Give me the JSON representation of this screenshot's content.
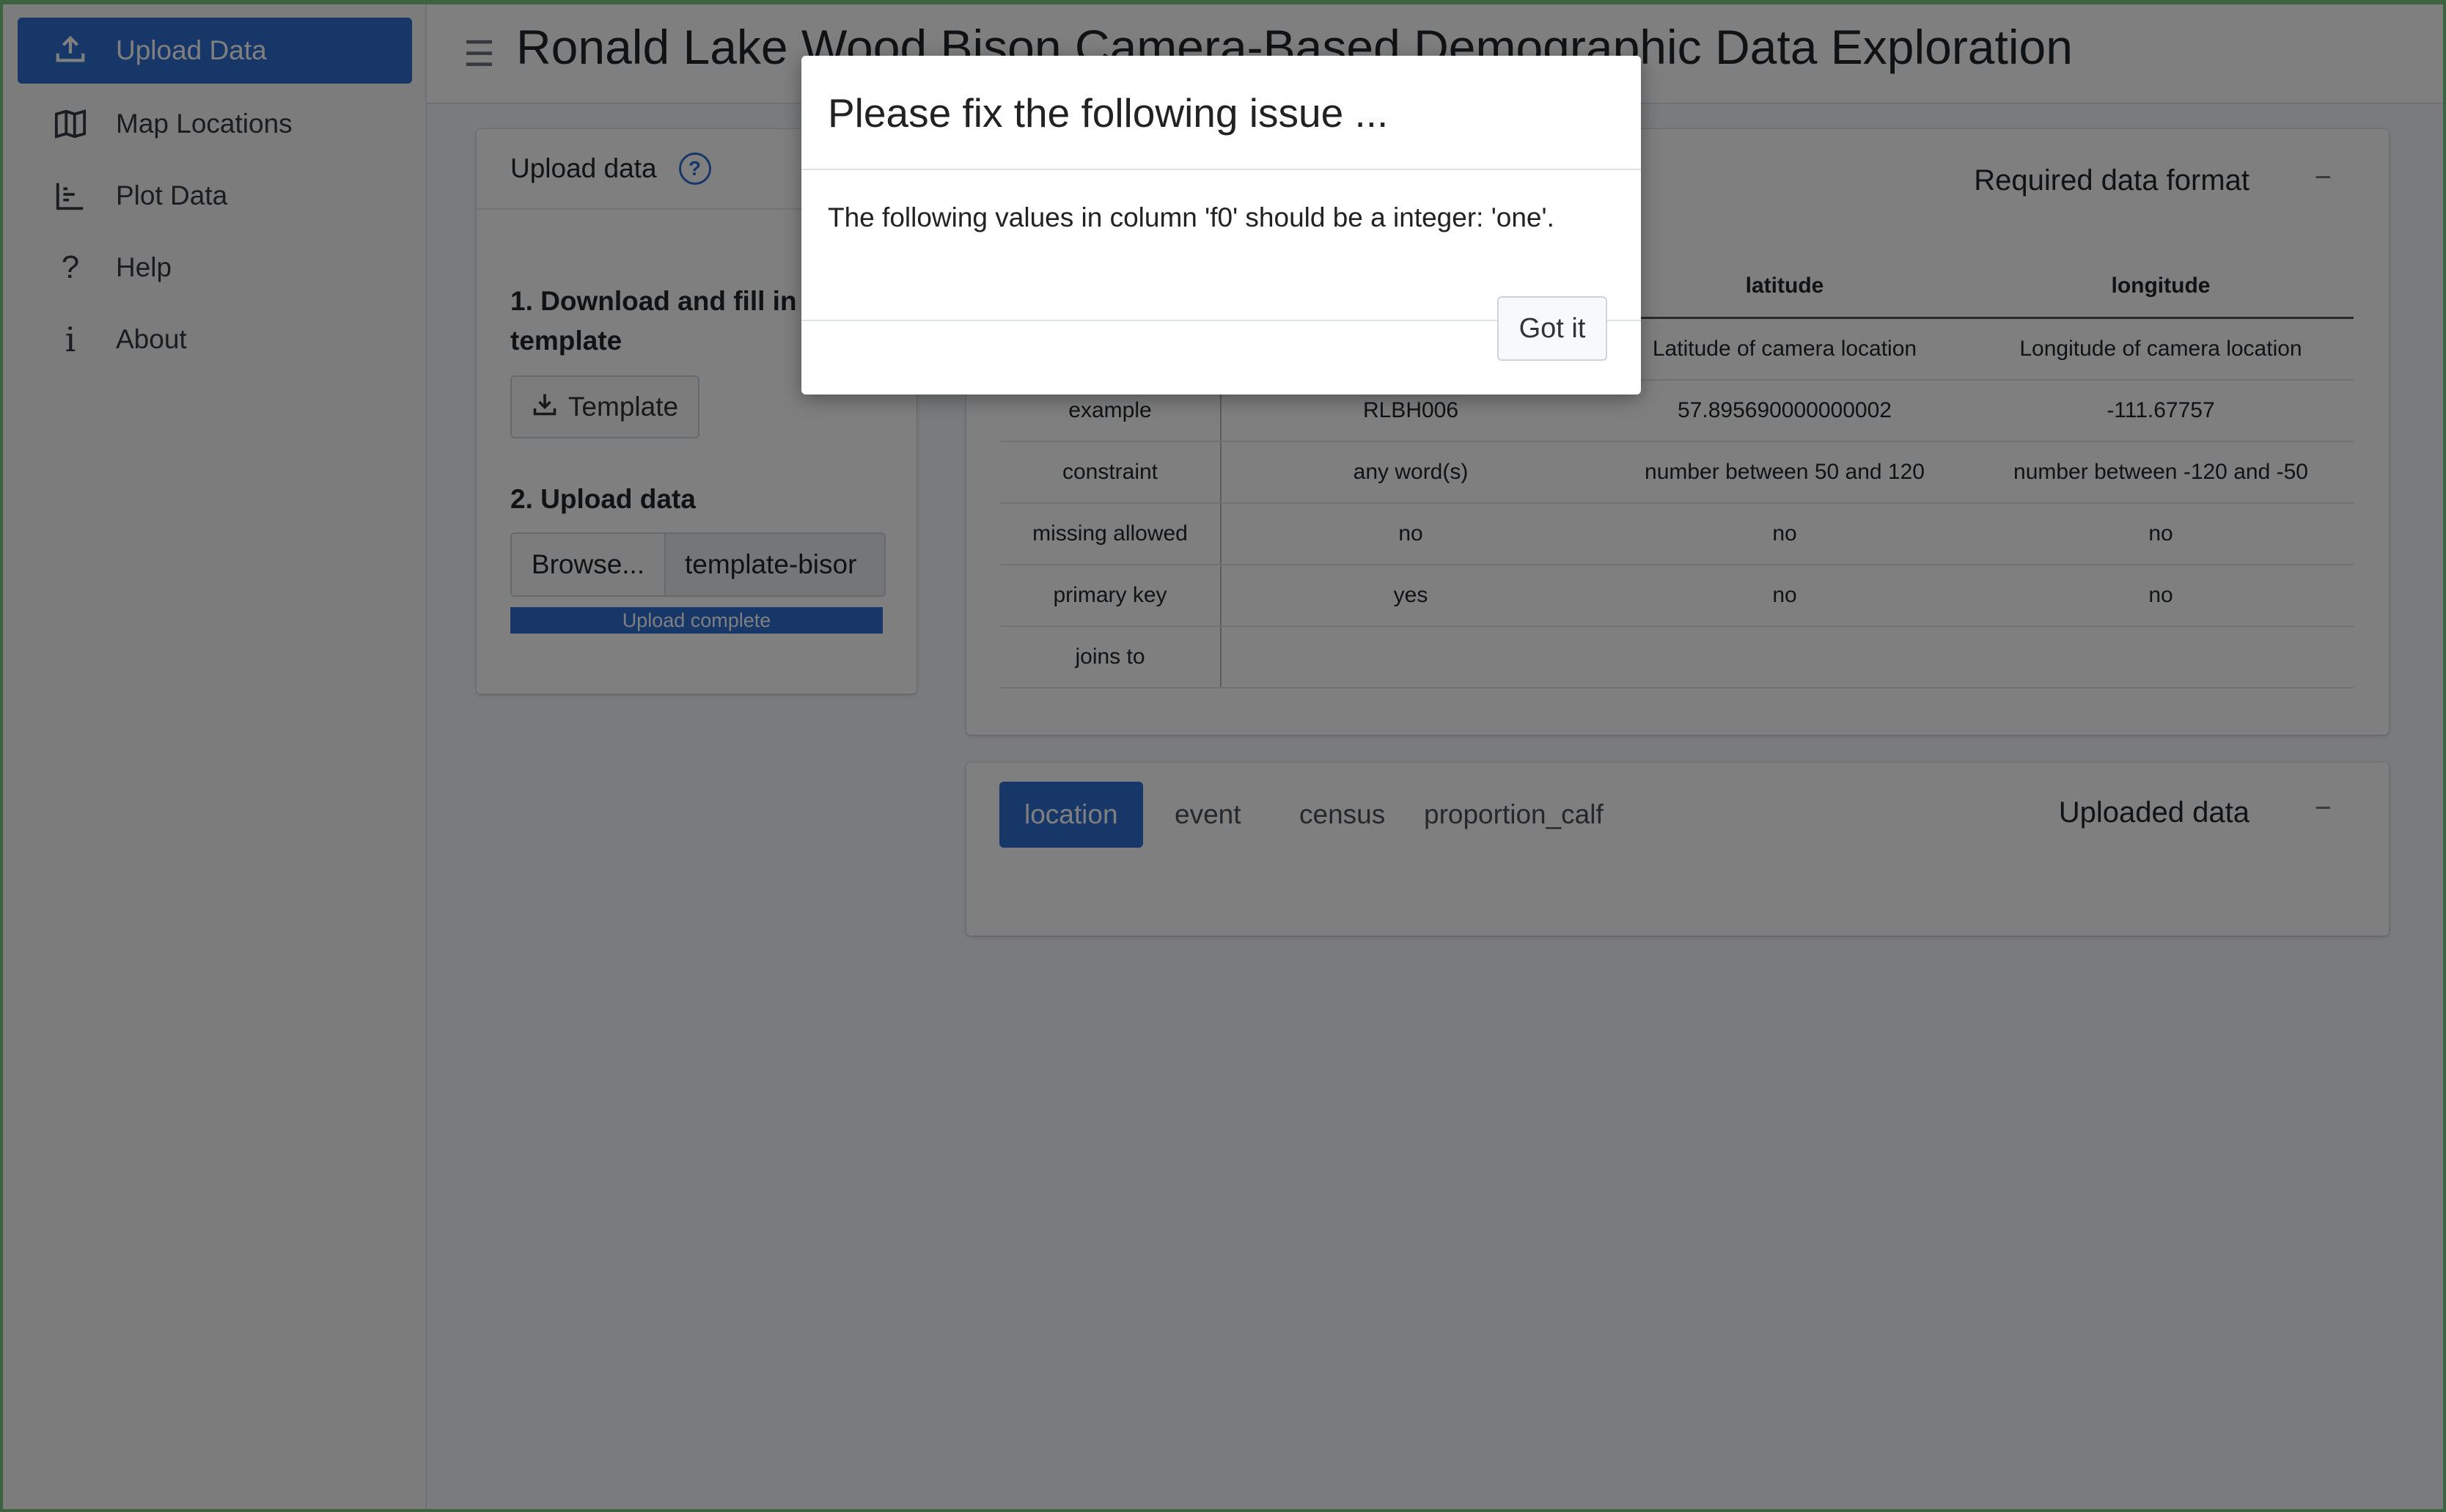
{
  "app": {
    "title": "Ronald Lake Wood Bison Camera-Based Demographic Data Exploration"
  },
  "sidebar": {
    "items": [
      {
        "label": "Upload Data",
        "icon": "upload-icon",
        "active": true
      },
      {
        "label": "Map Locations",
        "icon": "map-icon",
        "active": false
      },
      {
        "label": "Plot Data",
        "icon": "chart-icon",
        "active": false
      },
      {
        "label": "Help",
        "icon": "question-icon",
        "active": false
      },
      {
        "label": "About",
        "icon": "info-icon",
        "active": false
      }
    ]
  },
  "upload_card": {
    "title": "Upload data",
    "help_icon": "question-circle-icon",
    "step1": "1. Download and fill in template",
    "template_button": "Template",
    "step2": "2. Upload data",
    "browse_button": "Browse...",
    "file_name": "template-bisor",
    "progress_label": "Upload complete",
    "progress_value": 1.0
  },
  "format_card": {
    "title": "Required data format",
    "collapse_symbol": "−",
    "columns": [
      "",
      "",
      "latitude",
      "longitude"
    ],
    "rows": [
      [
        "",
        "",
        "Latitude of camera location",
        "Longitude of camera location"
      ],
      [
        "example",
        "RLBH006",
        "57.895690000000002",
        "-111.67757"
      ],
      [
        "constraint",
        "any word(s)",
        "number between 50 and 120",
        "number between -120 and -50"
      ],
      [
        "missing allowed",
        "no",
        "no",
        "no"
      ],
      [
        "primary key",
        "yes",
        "no",
        "no"
      ],
      [
        "joins to",
        "",
        "",
        ""
      ]
    ]
  },
  "data_card": {
    "title": "Uploaded data",
    "collapse_symbol": "−",
    "tabs": [
      {
        "label": "location",
        "active": true
      },
      {
        "label": "event",
        "active": false
      },
      {
        "label": "census",
        "active": false
      },
      {
        "label": "proportion_calf",
        "active": false
      }
    ]
  },
  "modal": {
    "title": "Please fix the following issue ...",
    "message": "The following values in column 'f0' should be a integer: 'one'.",
    "button": "Got it"
  },
  "colors": {
    "accent": "#2d6fd0",
    "backdrop": "rgba(0,0,0,0.5)"
  }
}
